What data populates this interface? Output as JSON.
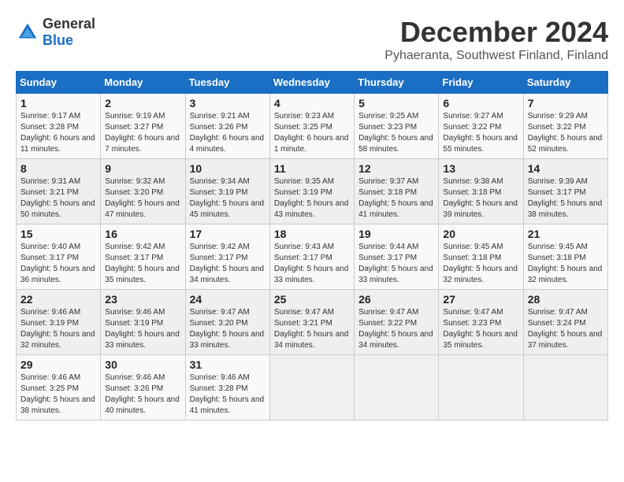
{
  "logo": {
    "general": "General",
    "blue": "Blue"
  },
  "title": "December 2024",
  "location": "Pyhaeranta, Southwest Finland, Finland",
  "days_of_week": [
    "Sunday",
    "Monday",
    "Tuesday",
    "Wednesday",
    "Thursday",
    "Friday",
    "Saturday"
  ],
  "weeks": [
    [
      {
        "day": "1",
        "sunrise": "9:17 AM",
        "sunset": "3:28 PM",
        "daylight": "6 hours and 11 minutes."
      },
      {
        "day": "2",
        "sunrise": "9:19 AM",
        "sunset": "3:27 PM",
        "daylight": "6 hours and 7 minutes."
      },
      {
        "day": "3",
        "sunrise": "9:21 AM",
        "sunset": "3:26 PM",
        "daylight": "6 hours and 4 minutes."
      },
      {
        "day": "4",
        "sunrise": "9:23 AM",
        "sunset": "3:25 PM",
        "daylight": "6 hours and 1 minute."
      },
      {
        "day": "5",
        "sunrise": "9:25 AM",
        "sunset": "3:23 PM",
        "daylight": "5 hours and 58 minutes."
      },
      {
        "day": "6",
        "sunrise": "9:27 AM",
        "sunset": "3:22 PM",
        "daylight": "5 hours and 55 minutes."
      },
      {
        "day": "7",
        "sunrise": "9:29 AM",
        "sunset": "3:22 PM",
        "daylight": "5 hours and 52 minutes."
      }
    ],
    [
      {
        "day": "8",
        "sunrise": "9:31 AM",
        "sunset": "3:21 PM",
        "daylight": "5 hours and 50 minutes."
      },
      {
        "day": "9",
        "sunrise": "9:32 AM",
        "sunset": "3:20 PM",
        "daylight": "5 hours and 47 minutes."
      },
      {
        "day": "10",
        "sunrise": "9:34 AM",
        "sunset": "3:19 PM",
        "daylight": "5 hours and 45 minutes."
      },
      {
        "day": "11",
        "sunrise": "9:35 AM",
        "sunset": "3:19 PM",
        "daylight": "5 hours and 43 minutes."
      },
      {
        "day": "12",
        "sunrise": "9:37 AM",
        "sunset": "3:18 PM",
        "daylight": "5 hours and 41 minutes."
      },
      {
        "day": "13",
        "sunrise": "9:38 AM",
        "sunset": "3:18 PM",
        "daylight": "5 hours and 39 minutes."
      },
      {
        "day": "14",
        "sunrise": "9:39 AM",
        "sunset": "3:17 PM",
        "daylight": "5 hours and 38 minutes."
      }
    ],
    [
      {
        "day": "15",
        "sunrise": "9:40 AM",
        "sunset": "3:17 PM",
        "daylight": "5 hours and 36 minutes."
      },
      {
        "day": "16",
        "sunrise": "9:42 AM",
        "sunset": "3:17 PM",
        "daylight": "5 hours and 35 minutes."
      },
      {
        "day": "17",
        "sunrise": "9:42 AM",
        "sunset": "3:17 PM",
        "daylight": "5 hours and 34 minutes."
      },
      {
        "day": "18",
        "sunrise": "9:43 AM",
        "sunset": "3:17 PM",
        "daylight": "5 hours and 33 minutes."
      },
      {
        "day": "19",
        "sunrise": "9:44 AM",
        "sunset": "3:17 PM",
        "daylight": "5 hours and 33 minutes."
      },
      {
        "day": "20",
        "sunrise": "9:45 AM",
        "sunset": "3:18 PM",
        "daylight": "5 hours and 32 minutes."
      },
      {
        "day": "21",
        "sunrise": "9:45 AM",
        "sunset": "3:18 PM",
        "daylight": "5 hours and 32 minutes."
      }
    ],
    [
      {
        "day": "22",
        "sunrise": "9:46 AM",
        "sunset": "3:19 PM",
        "daylight": "5 hours and 32 minutes."
      },
      {
        "day": "23",
        "sunrise": "9:46 AM",
        "sunset": "3:19 PM",
        "daylight": "5 hours and 33 minutes."
      },
      {
        "day": "24",
        "sunrise": "9:47 AM",
        "sunset": "3:20 PM",
        "daylight": "5 hours and 33 minutes."
      },
      {
        "day": "25",
        "sunrise": "9:47 AM",
        "sunset": "3:21 PM",
        "daylight": "5 hours and 34 minutes."
      },
      {
        "day": "26",
        "sunrise": "9:47 AM",
        "sunset": "3:22 PM",
        "daylight": "5 hours and 34 minutes."
      },
      {
        "day": "27",
        "sunrise": "9:47 AM",
        "sunset": "3:23 PM",
        "daylight": "5 hours and 35 minutes."
      },
      {
        "day": "28",
        "sunrise": "9:47 AM",
        "sunset": "3:24 PM",
        "daylight": "5 hours and 37 minutes."
      }
    ],
    [
      {
        "day": "29",
        "sunrise": "9:46 AM",
        "sunset": "3:25 PM",
        "daylight": "5 hours and 38 minutes."
      },
      {
        "day": "30",
        "sunrise": "9:46 AM",
        "sunset": "3:26 PM",
        "daylight": "5 hours and 40 minutes."
      },
      {
        "day": "31",
        "sunrise": "9:46 AM",
        "sunset": "3:28 PM",
        "daylight": "5 hours and 41 minutes."
      },
      null,
      null,
      null,
      null
    ]
  ]
}
